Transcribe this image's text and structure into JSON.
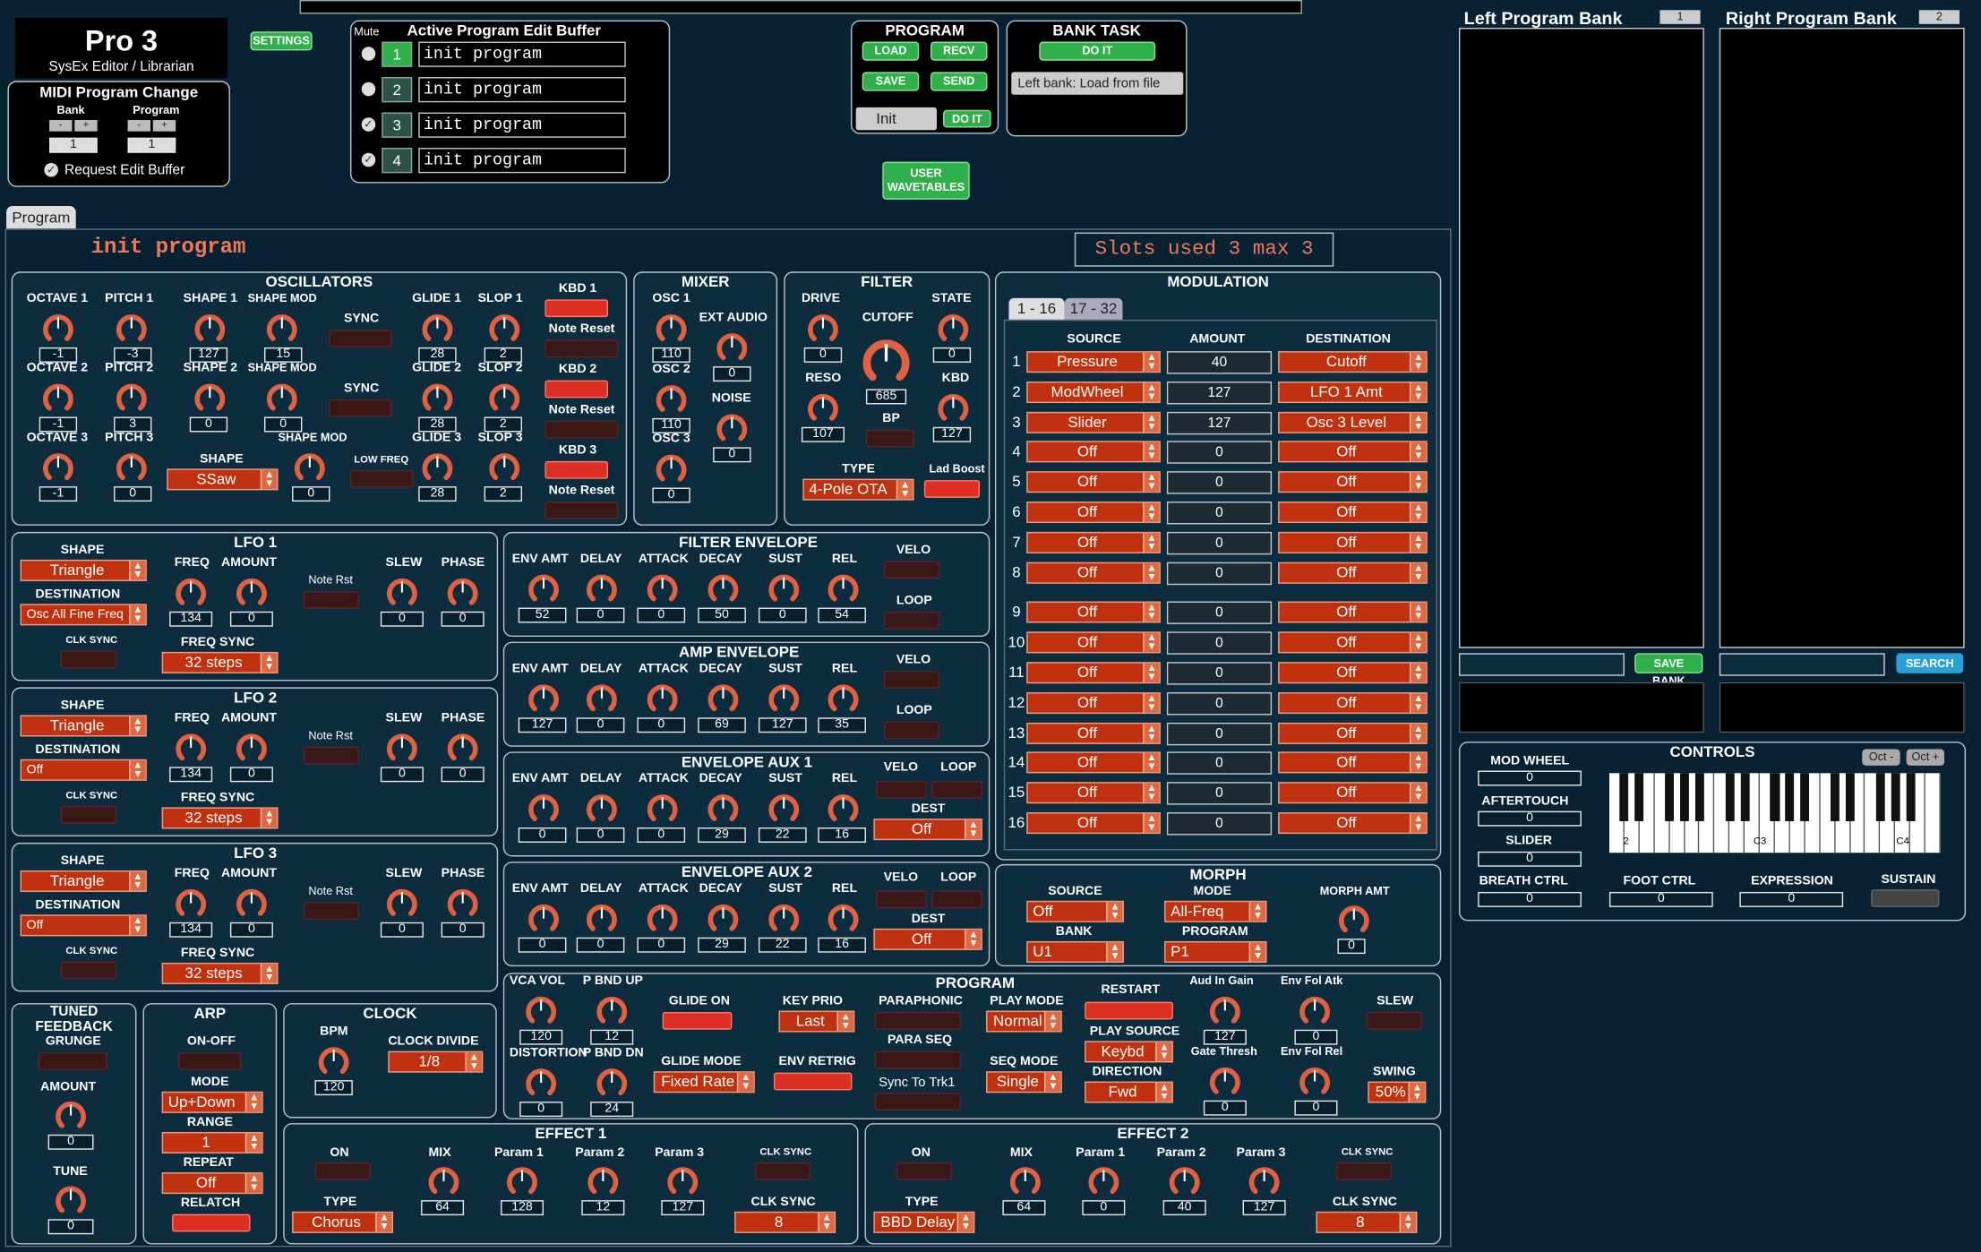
{
  "header": {
    "app": "Pro 3",
    "subtitle": "SysEx Editor / Librarian",
    "settings": "SETTINGS"
  },
  "midi_pc": {
    "title": "MIDI Program Change",
    "bank": "Bank",
    "program": "Program",
    "minus": "-",
    "plus": "+",
    "bank_val": "1",
    "program_val": "1",
    "request": "Request Edit Buffer"
  },
  "active_buffer": {
    "mute": "Mute",
    "title": "Active Program Edit Buffer",
    "slots": [
      {
        "n": "1",
        "name": "init program",
        "active": true
      },
      {
        "n": "2",
        "name": "init program",
        "active": false
      },
      {
        "n": "3",
        "name": "init program",
        "active": false
      },
      {
        "n": "4",
        "name": "init program",
        "active": false
      }
    ]
  },
  "program_box": {
    "title": "PROGRAM",
    "load": "LOAD",
    "recv": "RECV",
    "save": "SAVE",
    "send": "SEND",
    "select": "Init",
    "doit": "DO IT"
  },
  "bank_task": {
    "title": "BANK TASK",
    "doit": "DO IT",
    "select": "Left bank: Load from file"
  },
  "user_wavetables": "USER\nWAVETABLES",
  "tab": "Program",
  "program_name": "init program",
  "slots_used": "Slots used 3 max 3",
  "osc": {
    "title": "OSCILLATORS",
    "rows": [
      {
        "oct_l": "OCTAVE 1",
        "oct": "-1",
        "pitch_l": "PITCH 1",
        "pitch": "-3",
        "shape_l": "SHAPE 1",
        "shape": "127",
        "smod_l": "SHAPE MOD",
        "smod": "15",
        "sync": "SYNC",
        "glide_l": "GLIDE 1",
        "glide": "28",
        "slop_l": "SLOP 1",
        "slop": "2",
        "kbd": "KBD 1",
        "nr": "Note Reset"
      },
      {
        "oct_l": "OCTAVE 2",
        "oct": "-1",
        "pitch_l": "PITCH 2",
        "pitch": "3",
        "shape_l": "SHAPE 2",
        "shape": "0",
        "smod_l": "SHAPE MOD",
        "smod": "0",
        "sync": "SYNC",
        "glide_l": "GLIDE 2",
        "glide": "28",
        "slop_l": "SLOP 2",
        "slop": "2",
        "kbd": "KBD 2",
        "nr": "Note Reset"
      },
      {
        "oct_l": "OCTAVE 3",
        "oct": "-1",
        "pitch_l": "PITCH 3",
        "pitch": "0",
        "shape_l": "SHAPE",
        "shape": "SSaw",
        "smod_l": "SHAPE MOD",
        "smod": "0",
        "sync": "LOW FREQ",
        "glide_l": "GLIDE 3",
        "glide": "28",
        "slop_l": "SLOP 3",
        "slop": "2",
        "kbd": "KBD 3",
        "nr": "Note Reset"
      }
    ]
  },
  "mixer": {
    "title": "MIXER",
    "osc1": "OSC 1",
    "osc1v": "110",
    "ext": "EXT AUDIO",
    "extv": "0",
    "osc2": "OSC 2",
    "osc2v": "110",
    "noise": "NOISE",
    "noisev": "0",
    "osc3": "OSC 3",
    "osc3v": "0"
  },
  "filter": {
    "title": "FILTER",
    "drive": "DRIVE",
    "drivev": "0",
    "cutoff": "CUTOFF",
    "cutoffv": "685",
    "state": "STATE",
    "statev": "0",
    "reso": "RESO",
    "resov": "107",
    "bp": "BP",
    "kbd": "KBD",
    "kbdv": "127",
    "type": "TYPE",
    "typev": "4-Pole OTA",
    "lad": "Lad Boost"
  },
  "modulation": {
    "title": "MODULATION",
    "tab1": "1 - 16",
    "tab2": "17 - 32",
    "src_h": "SOURCE",
    "amt_h": "AMOUNT",
    "dst_h": "DESTINATION",
    "rows": [
      {
        "n": "1",
        "src": "Pressure",
        "amt": "40",
        "dst": "Cutoff"
      },
      {
        "n": "2",
        "src": "ModWheel",
        "amt": "127",
        "dst": "LFO 1 Amt"
      },
      {
        "n": "3",
        "src": "Slider",
        "amt": "127",
        "dst": "Osc 3 Level"
      },
      {
        "n": "4",
        "src": "Off",
        "amt": "0",
        "dst": "Off"
      },
      {
        "n": "5",
        "src": "Off",
        "amt": "0",
        "dst": "Off"
      },
      {
        "n": "6",
        "src": "Off",
        "amt": "0",
        "dst": "Off"
      },
      {
        "n": "7",
        "src": "Off",
        "amt": "0",
        "dst": "Off"
      },
      {
        "n": "8",
        "src": "Off",
        "amt": "0",
        "dst": "Off"
      },
      {
        "n": "9",
        "src": "Off",
        "amt": "0",
        "dst": "Off"
      },
      {
        "n": "10",
        "src": "Off",
        "amt": "0",
        "dst": "Off"
      },
      {
        "n": "11",
        "src": "Off",
        "amt": "0",
        "dst": "Off"
      },
      {
        "n": "12",
        "src": "Off",
        "amt": "0",
        "dst": "Off"
      },
      {
        "n": "13",
        "src": "Off",
        "amt": "0",
        "dst": "Off"
      },
      {
        "n": "14",
        "src": "Off",
        "amt": "0",
        "dst": "Off"
      },
      {
        "n": "15",
        "src": "Off",
        "amt": "0",
        "dst": "Off"
      },
      {
        "n": "16",
        "src": "Off",
        "amt": "0",
        "dst": "Off"
      }
    ]
  },
  "lfos": [
    {
      "title": "LFO 1",
      "shape_l": "SHAPE",
      "shape": "Triangle",
      "dest_l": "DESTINATION",
      "dest": "Osc All Fine Freq",
      "clk": "CLK SYNC",
      "freq_l": "FREQ",
      "freq": "134",
      "amt_l": "AMOUNT",
      "amt": "0",
      "nr": "Note Rst",
      "slew_l": "SLEW",
      "slew": "0",
      "phase_l": "PHASE",
      "phase": "0",
      "fs_l": "FREQ SYNC",
      "fs": "32 steps"
    },
    {
      "title": "LFO 2",
      "shape_l": "SHAPE",
      "shape": "Triangle",
      "dest_l": "DESTINATION",
      "dest": "Off",
      "clk": "CLK SYNC",
      "freq_l": "FREQ",
      "freq": "134",
      "amt_l": "AMOUNT",
      "amt": "0",
      "nr": "Note Rst",
      "slew_l": "SLEW",
      "slew": "0",
      "phase_l": "PHASE",
      "phase": "0",
      "fs_l": "FREQ SYNC",
      "fs": "32 steps"
    },
    {
      "title": "LFO 3",
      "shape_l": "SHAPE",
      "shape": "Triangle",
      "dest_l": "DESTINATION",
      "dest": "Off",
      "clk": "CLK SYNC",
      "freq_l": "FREQ",
      "freq": "134",
      "amt_l": "AMOUNT",
      "amt": "0",
      "nr": "Note Rst",
      "slew_l": "SLEW",
      "slew": "0",
      "phase_l": "PHASE",
      "phase": "0",
      "fs_l": "FREQ SYNC",
      "fs": "32 steps"
    }
  ],
  "envs": [
    {
      "title": "FILTER ENVELOPE",
      "labels": [
        "ENV AMT",
        "DELAY",
        "ATTACK",
        "DECAY",
        "SUST",
        "REL"
      ],
      "vals": [
        "52",
        "0",
        "0",
        "50",
        "0",
        "54"
      ],
      "velo": "VELO",
      "loop": "LOOP",
      "dest_l": "",
      "dest": ""
    },
    {
      "title": "AMP ENVELOPE",
      "labels": [
        "ENV AMT",
        "DELAY",
        "ATTACK",
        "DECAY",
        "SUST",
        "REL"
      ],
      "vals": [
        "127",
        "0",
        "0",
        "69",
        "127",
        "35"
      ],
      "velo": "VELO",
      "loop": "LOOP",
      "dest_l": "",
      "dest": ""
    },
    {
      "title": "ENVELOPE AUX 1",
      "labels": [
        "ENV AMT",
        "DELAY",
        "ATTACK",
        "DECAY",
        "SUST",
        "REL"
      ],
      "vals": [
        "0",
        "0",
        "0",
        "29",
        "22",
        "16"
      ],
      "velo": "VELO",
      "loop": "LOOP",
      "dest_l": "DEST",
      "dest": "Off"
    },
    {
      "title": "ENVELOPE AUX 2",
      "labels": [
        "ENV AMT",
        "DELAY",
        "ATTACK",
        "DECAY",
        "SUST",
        "REL"
      ],
      "vals": [
        "0",
        "0",
        "0",
        "29",
        "22",
        "16"
      ],
      "velo": "VELO",
      "loop": "LOOP",
      "dest_l": "DEST",
      "dest": "Off"
    }
  ],
  "morph": {
    "title": "MORPH",
    "src_l": "SOURCE",
    "src": "Off",
    "mode_l": "MODE",
    "mode": "All-Freq",
    "amt_l": "MORPH AMT",
    "amt": "0",
    "bank_l": "BANK",
    "bank": "U1",
    "prog_l": "PROGRAM",
    "prog": "P1"
  },
  "program": {
    "title": "PROGRAM",
    "vca_l": "VCA VOL",
    "vca": "120",
    "pbu_l": "P BND UP",
    "pbu": "12",
    "glide_on": "GLIDE ON",
    "keyprio_l": "KEY PRIO",
    "keyprio": "Last",
    "para": "PARAPHONIC",
    "playmode_l": "PLAY MODE",
    "playmode": "Normal",
    "restart": "RESTART",
    "aud_l": "Aud In Gain",
    "aud": "127",
    "efa_l": "Env Fol Atk",
    "efa": "0",
    "slew": "SLEW",
    "dist_l": "DISTORTION",
    "dist": "0",
    "pbd_l": "P BND DN",
    "pbd": "24",
    "glidemode_l": "GLIDE MODE",
    "glidemode": "Fixed Rate",
    "envretrig": "ENV RETRIG",
    "paraseq": "PARA SEQ",
    "sync_trk": "Sync To Trk1",
    "seqmode_l": "SEQ MODE",
    "seqmode": "Single",
    "playsrc_l": "PLAY SOURCE",
    "playsrc": "Keybd",
    "dir_l": "DIRECTION",
    "dir": "Fwd",
    "gate_l": "Gate Thresh",
    "gate": "0",
    "efr_l": "Env Fol Rel",
    "efr": "0",
    "swing_l": "SWING",
    "swing": "50%"
  },
  "tuned": {
    "title": "TUNED FEEDBACK",
    "grunge": "GRUNGE",
    "amt_l": "AMOUNT",
    "amt": "0",
    "tune_l": "TUNE",
    "tune": "0"
  },
  "arp": {
    "title": "ARP",
    "onoff": "ON-OFF",
    "mode_l": "MODE",
    "mode": "Up+Down",
    "range_l": "RANGE",
    "range": "1",
    "repeat_l": "REPEAT",
    "repeat": "Off",
    "relatch": "RELATCH"
  },
  "clock": {
    "title": "CLOCK",
    "bpm_l": "BPM",
    "bpm": "120",
    "div_l": "CLOCK DIVIDE",
    "div": "1/8"
  },
  "effects": [
    {
      "title": "EFFECT 1",
      "on": "ON",
      "type_l": "TYPE",
      "type": "Chorus",
      "mix_l": "MIX",
      "mix": "64",
      "p1_l": "Param 1",
      "p1": "128",
      "p2_l": "Param 2",
      "p2": "12",
      "p3_l": "Param 3",
      "p3": "127",
      "clk_l": "CLK SYNC",
      "cs_l": "CLK SYNC",
      "cs": "8"
    },
    {
      "title": "EFFECT 2",
      "on": "ON",
      "type_l": "TYPE",
      "type": "BBD Delay",
      "mix_l": "MIX",
      "mix": "64",
      "p1_l": "Param 1",
      "p1": "0",
      "p2_l": "Param 2",
      "p2": "40",
      "p3_l": "Param 3",
      "p3": "127",
      "clk_l": "CLK SYNC",
      "cs_l": "CLK SYNC",
      "cs": "8"
    }
  ],
  "banks": {
    "left": "Left Program Bank",
    "left_n": "1",
    "right": "Right Program Bank",
    "right_n": "2",
    "save_bank": "SAVE BANK",
    "search": "SEARCH"
  },
  "controls": {
    "title": "CONTROLS",
    "octm": "Oct -",
    "octp": "Oct +",
    "modwheel": "MOD WHEEL",
    "modwheel_v": "0",
    "aftertouch": "AFTERTOUCH",
    "aftertouch_v": "0",
    "slider": "SLIDER",
    "slider_v": "0",
    "breath": "BREATH CTRL",
    "breath_v": "0",
    "foot": "FOOT CTRL",
    "foot_v": "0",
    "expr": "EXPRESSION",
    "expr_v": "0",
    "sustain": "SUSTAIN",
    "c2": "2",
    "c3": "C3",
    "c4": "C4"
  },
  "colors": {
    "bg": "#082233",
    "knob": "#e06040",
    "toggle_on": "#dc2e22",
    "toggle_off": "#3a1818",
    "green": "#2fb04a",
    "blue": "#2aa0d8"
  }
}
